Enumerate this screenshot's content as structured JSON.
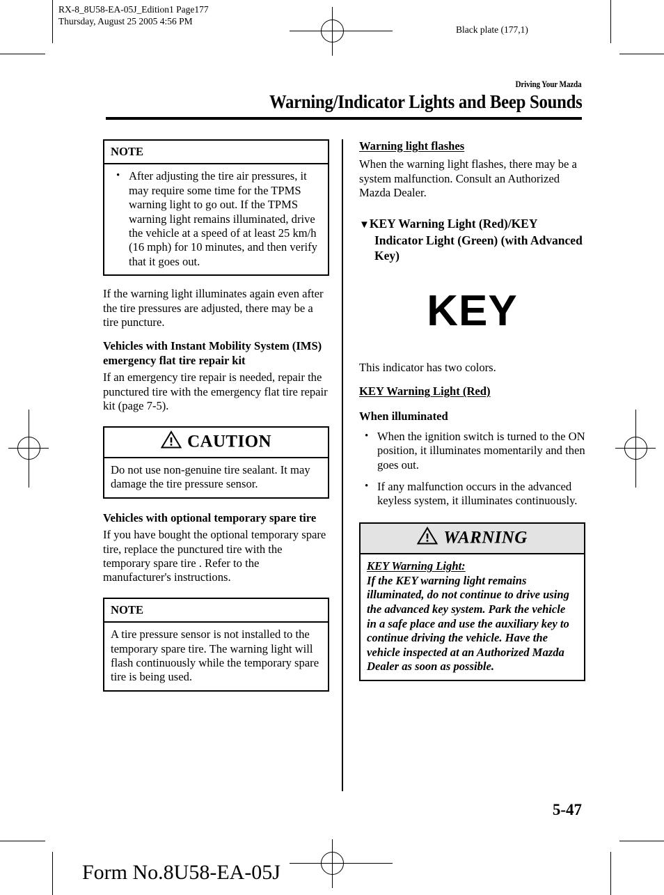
{
  "prepress": {
    "slug_left_line1": "RX-8_8U58-EA-05J_Edition1 Page177",
    "slug_left_line2": "Thursday, August 25 2005 4:56 PM",
    "slug_right": "Black plate (177,1)"
  },
  "header": {
    "kicker": "Driving Your Mazda",
    "title": "Warning/Indicator Lights and Beep Sounds"
  },
  "left_column": {
    "note_box_1": {
      "heading": "NOTE",
      "bullets": [
        "After adjusting the tire air pressures, it may require some time for the TPMS warning light to go out. If the TPMS warning light remains illuminated, drive the vehicle at a speed of at least 25 km/h (16 mph) for 10 minutes, and then verify that it goes out."
      ]
    },
    "para_1": "If the warning light illuminates again even after the tire pressures are adjusted, there may be a tire puncture.",
    "heading_ims": "Vehicles with Instant Mobility System (IMS) emergency flat tire repair kit",
    "para_2": "If an emergency tire repair is needed, repair the punctured tire with the emergency flat tire repair kit (page 7-5).",
    "caution_box": {
      "heading": "CAUTION",
      "icon": "warning-triangle-icon",
      "body": "Do not use non-genuine tire sealant. It may damage the tire pressure sensor."
    },
    "heading_spare": "Vehicles with optional temporary spare tire",
    "para_3": "If you have bought the optional temporary spare tire, replace the punctured tire with the temporary spare tire . Refer to the manufacturer's instructions.",
    "note_box_2": {
      "heading": "NOTE",
      "body": "A tire pressure sensor is not installed to the temporary spare tire. The warning light will flash continuously while the temporary spare tire is being used."
    }
  },
  "right_column": {
    "heading_flashes": "Warning light flashes",
    "para_1": "When the warning light flashes, there may be a system malfunction. Consult an Authorized Mazda Dealer.",
    "marker": "▼",
    "heading_key": "KEY Warning Light (Red)/KEY Indicator Light (Green) (with Advanced Key)",
    "key_symbol": "KEY",
    "para_2": "This indicator has two colors.",
    "heading_key_red": "KEY Warning Light (Red)",
    "heading_when_illuminated": "When illuminated",
    "bullets": [
      "When the ignition switch is turned to the ON position, it illuminates momentarily and then goes out.",
      "If any malfunction occurs in the advanced keyless system, it illuminates continuously."
    ],
    "warning_box": {
      "heading": "WARNING",
      "icon": "warning-triangle-icon",
      "lead": "KEY Warning Light:",
      "body": "If the KEY warning light remains illuminated, do not continue to drive using the advanced key system. Park the vehicle in a safe place and use the auxiliary key to continue driving the vehicle. Have the vehicle inspected at an Authorized Mazda Dealer as soon as possible."
    }
  },
  "footer": {
    "page_number": "5-47",
    "form_number": "Form No.8U58-EA-05J"
  },
  "colors": {
    "warning_header_background": "#e3e3e3",
    "ink": "#000000",
    "paper": "#ffffff"
  }
}
